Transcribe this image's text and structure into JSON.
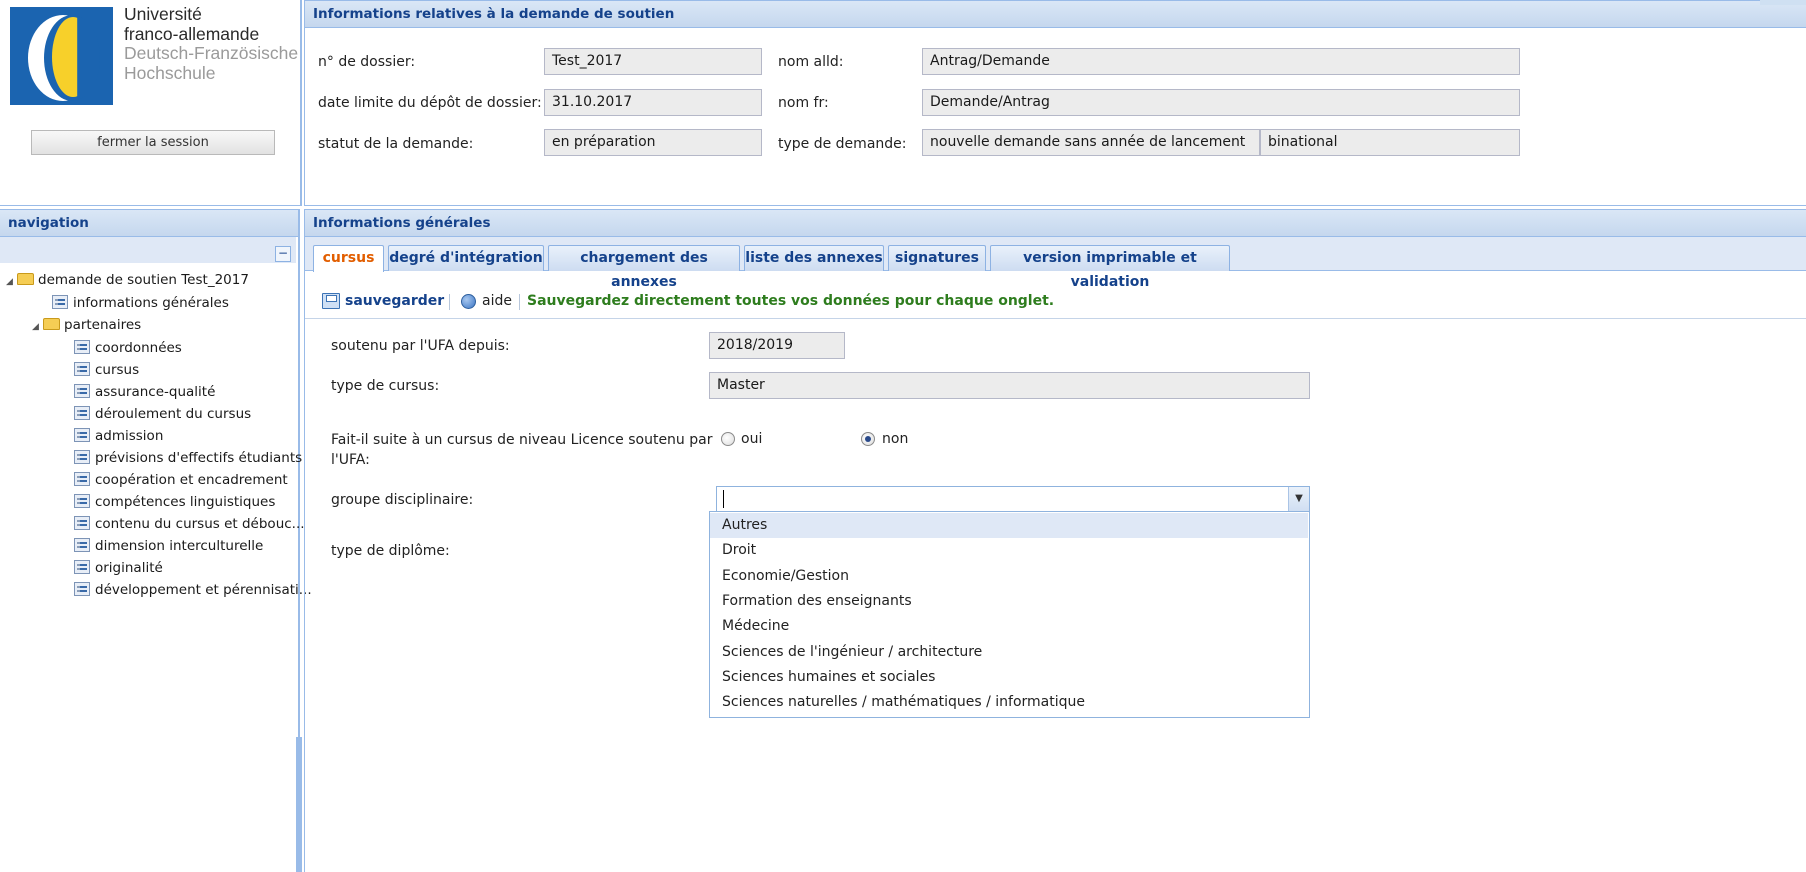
{
  "logo": {
    "lines": [
      "Université",
      "franco-allemande",
      "Deutsch-Französische",
      "Hochschule"
    ]
  },
  "session": {
    "logout_label": "fermer la session"
  },
  "info": {
    "title": "Informations relatives à la demande de soutien",
    "dossier_label": "n° de dossier:",
    "dossier_value": "Test_2017",
    "deadline_label": "date limite du dépôt de dossier:",
    "deadline_value": "31.10.2017",
    "status_label": "statut de la demande:",
    "status_value": "en préparation",
    "name_de_label": "nom alld:",
    "name_de_value": "Antrag/Demande",
    "name_fr_label": "nom fr:",
    "name_fr_value": "Demande/Antrag",
    "type_label": "type de demande:",
    "type_value": "nouvelle demande sans année de lancement",
    "type_value2": "binational"
  },
  "nav": {
    "title": "navigation",
    "collapse_symbol": "−",
    "root": "demande de soutien Test_2017",
    "general": "informations générales",
    "partners": "partenaires",
    "items": [
      "coordonnées",
      "cursus",
      "assurance-qualité",
      "déroulement du cursus",
      "admission",
      "prévisions d'effectifs étudiants",
      "coopération et encadrement",
      "compétences linguistiques",
      "contenu du cursus et débouc...",
      "dimension interculturelle",
      "originalité",
      "développement et pérennisati..."
    ]
  },
  "main": {
    "title": "Informations générales",
    "tabs": [
      "cursus",
      "degré d'intégration",
      "chargement des annexes",
      "liste des annexes",
      "signatures",
      "version imprimable et validation"
    ],
    "save_label": "sauvegarder",
    "help_label": "aide",
    "save_hint": "Sauvegardez directement toutes vos données pour chaque onglet.",
    "since_label": "soutenu par l'UFA depuis:",
    "since_value": "2018/2019",
    "cursus_type_label": "type de cursus:",
    "cursus_type_value": "Master",
    "licence_question_line1": "Fait-il suite à un cursus de niveau Licence soutenu par",
    "licence_question_line2": "l'UFA:",
    "radio_yes": "oui",
    "radio_no": "non",
    "radio_selected": "non",
    "discipline_label": "groupe disciplinaire:",
    "discipline_value": "",
    "diploma_label": "type de diplôme:",
    "discipline_options": [
      "Autres",
      "Droit",
      "Economie/Gestion",
      "Formation des enseignants",
      "Médecine",
      "Sciences de l'ingénieur / architecture",
      "Sciences humaines et sociales",
      "Sciences naturelles / mathématiques / informatique"
    ],
    "highlighted_option": "Autres"
  },
  "colors": {
    "header_text": "#15428b",
    "active_tab": "#e25e00",
    "hint_green": "#2e7d1e",
    "panel_border": "#99bbe8"
  }
}
